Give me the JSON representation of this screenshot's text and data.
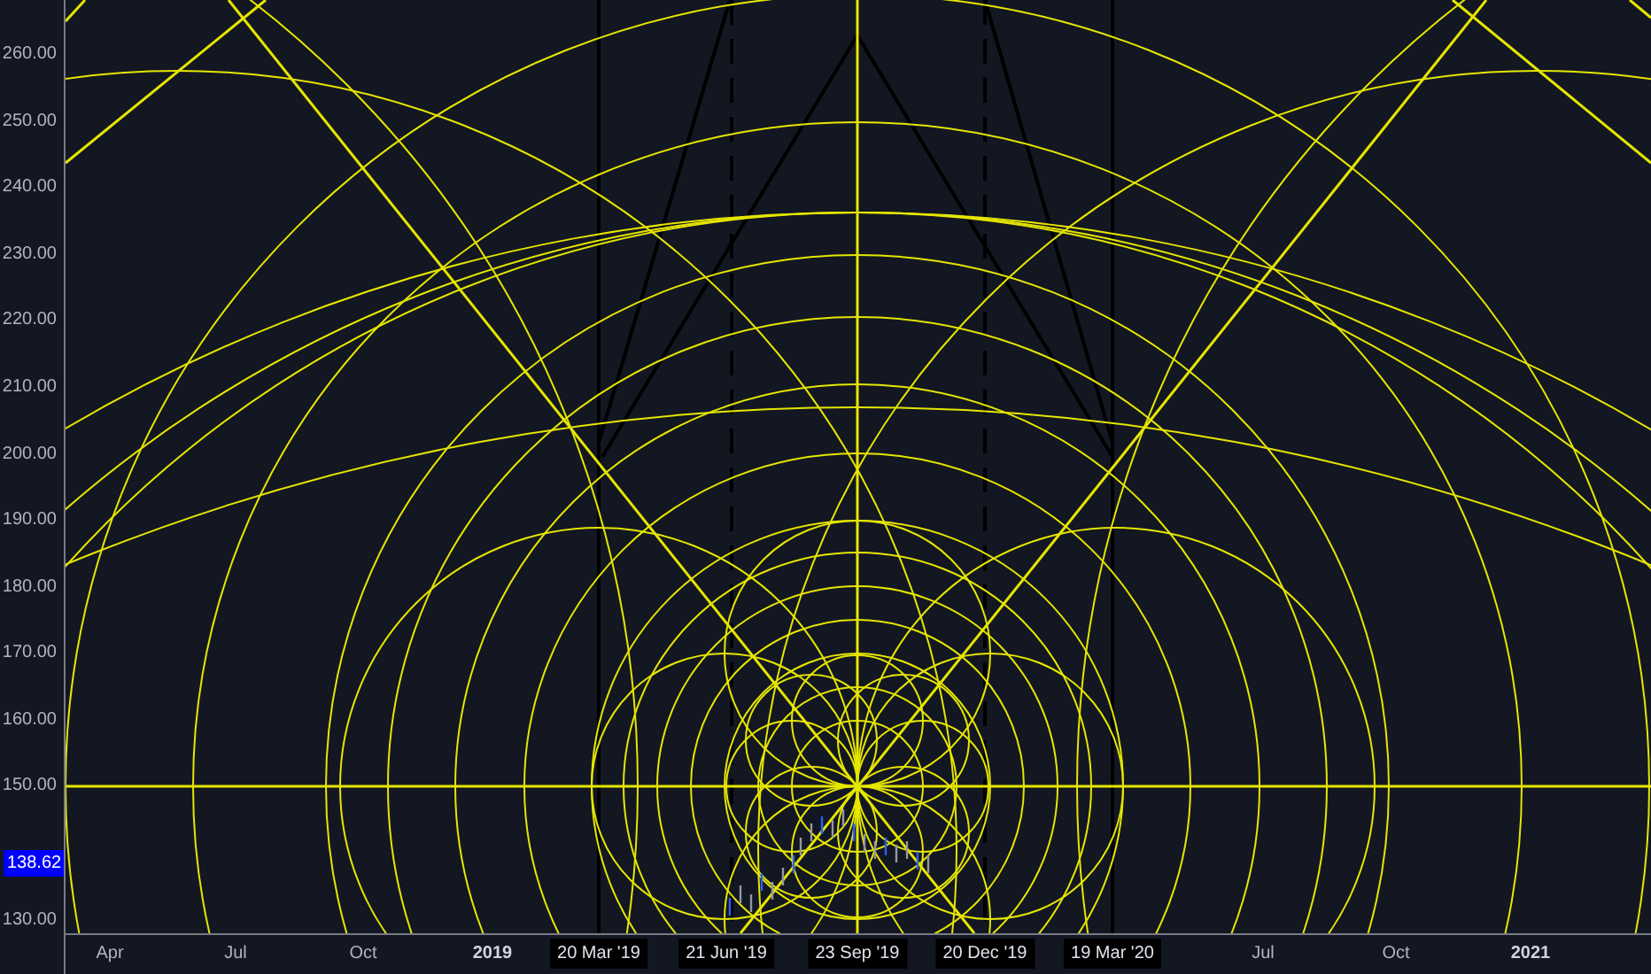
{
  "price_axis": {
    "labels": [
      "260.00",
      "250.00",
      "240.00",
      "230.00",
      "220.00",
      "210.00",
      "200.00",
      "190.00",
      "180.00",
      "170.00",
      "160.00",
      "150.00",
      "130.00"
    ]
  },
  "current_price": {
    "label": "138.62"
  },
  "time_axis": {
    "labels": [
      {
        "text": "Apr",
        "kind": "tick"
      },
      {
        "text": "Jul",
        "kind": "tick"
      },
      {
        "text": "Oct",
        "kind": "tick"
      },
      {
        "text": "2019",
        "kind": "year"
      },
      {
        "text": "20 Mar '19",
        "kind": "marker"
      },
      {
        "text": "21 Jun '19",
        "kind": "marker"
      },
      {
        "text": "23 Sep '19",
        "kind": "marker"
      },
      {
        "text": "20 Dec '19",
        "kind": "marker"
      },
      {
        "text": "19 Mar '20",
        "kind": "marker"
      },
      {
        "text": "Jul",
        "kind": "tick"
      },
      {
        "text": "Oct",
        "kind": "tick"
      },
      {
        "text": "2021",
        "kind": "year"
      }
    ]
  }
}
